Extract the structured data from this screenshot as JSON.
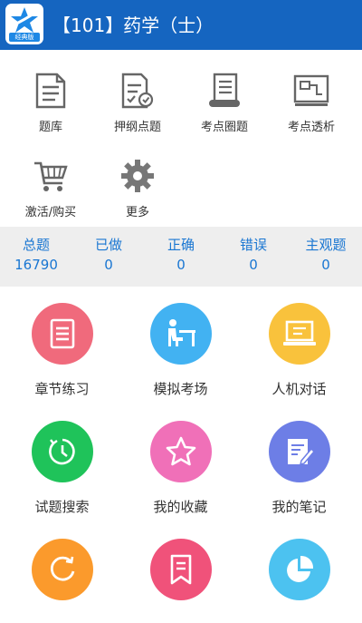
{
  "header": {
    "logo_tag": "经典版",
    "title": "【101】药学（士）"
  },
  "tools": [
    {
      "label": "题库",
      "icon": "document-icon"
    },
    {
      "label": "押纲点题",
      "icon": "checklist-icon"
    },
    {
      "label": "考点圈题",
      "icon": "scroll-icon"
    },
    {
      "label": "考点透析",
      "icon": "board-icon"
    },
    {
      "label": "激活/购买",
      "icon": "cart-icon"
    },
    {
      "label": "更多",
      "icon": "gear-icon"
    }
  ],
  "stats": [
    {
      "label": "总题",
      "value": "16790"
    },
    {
      "label": "已做",
      "value": "0"
    },
    {
      "label": "正确",
      "value": "0"
    },
    {
      "label": "错误",
      "value": "0"
    },
    {
      "label": "主观题",
      "value": "0"
    }
  ],
  "features": [
    {
      "label": "章节练习",
      "icon": "notebook-icon",
      "color": "#f06a7c"
    },
    {
      "label": "模拟考场",
      "icon": "exam-desk-icon",
      "color": "#42b2f2"
    },
    {
      "label": "人机对话",
      "icon": "laptop-icon",
      "color": "#f9c23c"
    },
    {
      "label": "试题搜索",
      "icon": "clock-search-icon",
      "color": "#1fc35a"
    },
    {
      "label": "我的收藏",
      "icon": "star-icon",
      "color": "#f070b8"
    },
    {
      "label": "我的笔记",
      "icon": "note-edit-icon",
      "color": "#6d7ee6"
    },
    {
      "label": "",
      "icon": "refresh-icon",
      "color": "#fb9a2c"
    },
    {
      "label": "",
      "icon": "bookmark-icon",
      "color": "#f0527a"
    },
    {
      "label": "",
      "icon": "pie-chart-icon",
      "color": "#4cc2f0"
    }
  ]
}
